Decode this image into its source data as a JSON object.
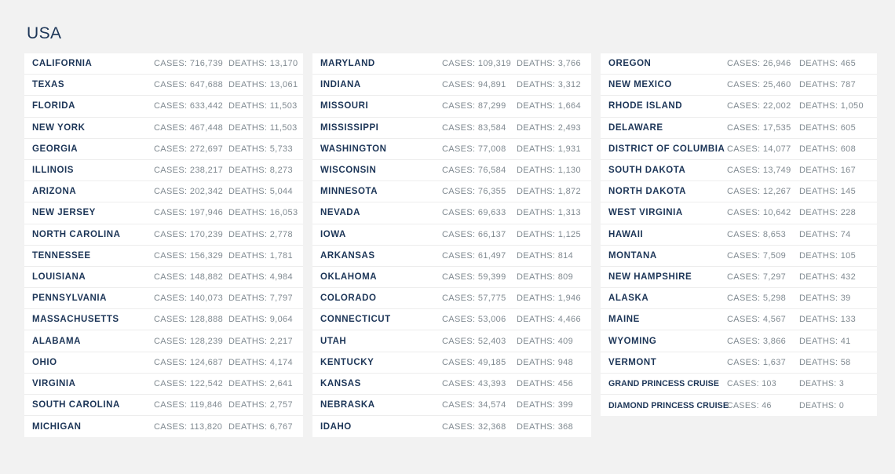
{
  "header": {
    "title": "USA"
  },
  "labels": {
    "cases_prefix": "CASES:",
    "deaths_prefix": "DEATHS:"
  },
  "colors": {
    "background": "#f2f2f2",
    "card": "#ffffff",
    "state_text": "#1c3557",
    "metric_text": "#808a91",
    "row_divider": "#ededed",
    "title": "#1c3557"
  },
  "columns": [
    {
      "rows": [
        {
          "state": "CALIFORNIA",
          "cases": "CASES: 716,739",
          "deaths": "DEATHS: 13,170"
        },
        {
          "state": "TEXAS",
          "cases": "CASES: 647,688",
          "deaths": "DEATHS: 13,061"
        },
        {
          "state": "FLORIDA",
          "cases": "CASES: 633,442",
          "deaths": "DEATHS: 11,503"
        },
        {
          "state": "NEW YORK",
          "cases": "CASES: 467,448",
          "deaths": "DEATHS: 11,503"
        },
        {
          "state": "GEORGIA",
          "cases": "CASES: 272,697",
          "deaths": "DEATHS: 5,733"
        },
        {
          "state": "ILLINOIS",
          "cases": "CASES: 238,217",
          "deaths": "DEATHS: 8,273"
        },
        {
          "state": "ARIZONA",
          "cases": "CASES: 202,342",
          "deaths": "DEATHS: 5,044"
        },
        {
          "state": "NEW JERSEY",
          "cases": "CASES: 197,946",
          "deaths": "DEATHS: 16,053"
        },
        {
          "state": "NORTH CAROLINA",
          "cases": "CASES: 170,239",
          "deaths": "DEATHS: 2,778"
        },
        {
          "state": "TENNESSEE",
          "cases": "CASES: 156,329",
          "deaths": "DEATHS: 1,781"
        },
        {
          "state": "LOUISIANA",
          "cases": "CASES: 148,882",
          "deaths": "DEATHS: 4,984"
        },
        {
          "state": "PENNSYLVANIA",
          "cases": "CASES: 140,073",
          "deaths": "DEATHS: 7,797"
        },
        {
          "state": "MASSACHUSETTS",
          "cases": "CASES: 128,888",
          "deaths": "DEATHS: 9,064"
        },
        {
          "state": "ALABAMA",
          "cases": "CASES: 128,239",
          "deaths": "DEATHS: 2,217"
        },
        {
          "state": "OHIO",
          "cases": "CASES: 124,687",
          "deaths": "DEATHS: 4,174"
        },
        {
          "state": "VIRGINIA",
          "cases": "CASES: 122,542",
          "deaths": "DEATHS: 2,641"
        },
        {
          "state": "SOUTH CAROLINA",
          "cases": "CASES: 119,846",
          "deaths": "DEATHS: 2,757"
        },
        {
          "state": "MICHIGAN",
          "cases": "CASES: 113,820",
          "deaths": "DEATHS: 6,767"
        }
      ]
    },
    {
      "rows": [
        {
          "state": "MARYLAND",
          "cases": "CASES: 109,319",
          "deaths": "DEATHS: 3,766"
        },
        {
          "state": "INDIANA",
          "cases": "CASES: 94,891",
          "deaths": "DEATHS: 3,312"
        },
        {
          "state": "MISSOURI",
          "cases": "CASES: 87,299",
          "deaths": "DEATHS: 1,664"
        },
        {
          "state": "MISSISSIPPI",
          "cases": "CASES: 83,584",
          "deaths": "DEATHS: 2,493"
        },
        {
          "state": "WASHINGTON",
          "cases": "CASES: 77,008",
          "deaths": "DEATHS: 1,931"
        },
        {
          "state": "WISCONSIN",
          "cases": "CASES: 76,584",
          "deaths": "DEATHS: 1,130"
        },
        {
          "state": "MINNESOTA",
          "cases": "CASES: 76,355",
          "deaths": "DEATHS: 1,872"
        },
        {
          "state": "NEVADA",
          "cases": "CASES: 69,633",
          "deaths": "DEATHS: 1,313"
        },
        {
          "state": "IOWA",
          "cases": "CASES: 66,137",
          "deaths": "DEATHS: 1,125"
        },
        {
          "state": "ARKANSAS",
          "cases": "CASES: 61,497",
          "deaths": "DEATHS: 814"
        },
        {
          "state": "OKLAHOMA",
          "cases": "CASES: 59,399",
          "deaths": "DEATHS: 809"
        },
        {
          "state": "COLORADO",
          "cases": "CASES: 57,775",
          "deaths": "DEATHS: 1,946"
        },
        {
          "state": "CONNECTICUT",
          "cases": "CASES: 53,006",
          "deaths": "DEATHS: 4,466"
        },
        {
          "state": "UTAH",
          "cases": "CASES: 52,403",
          "deaths": "DEATHS: 409"
        },
        {
          "state": "KENTUCKY",
          "cases": "CASES: 49,185",
          "deaths": "DEATHS: 948"
        },
        {
          "state": "KANSAS",
          "cases": "CASES: 43,393",
          "deaths": "DEATHS: 456"
        },
        {
          "state": "NEBRASKA",
          "cases": "CASES: 34,574",
          "deaths": "DEATHS: 399"
        },
        {
          "state": "IDAHO",
          "cases": "CASES: 32,368",
          "deaths": "DEATHS: 368"
        }
      ]
    },
    {
      "rows": [
        {
          "state": "OREGON",
          "cases": "CASES: 26,946",
          "deaths": "DEATHS: 465"
        },
        {
          "state": "NEW MEXICO",
          "cases": "CASES: 25,460",
          "deaths": "DEATHS: 787"
        },
        {
          "state": "RHODE ISLAND",
          "cases": "CASES: 22,002",
          "deaths": "DEATHS: 1,050"
        },
        {
          "state": "DELAWARE",
          "cases": "CASES: 17,535",
          "deaths": "DEATHS: 605"
        },
        {
          "state": "DISTRICT OF COLUMBIA",
          "cases": "CASES: 14,077",
          "deaths": "DEATHS: 608"
        },
        {
          "state": "SOUTH DAKOTA",
          "cases": "CASES: 13,749",
          "deaths": "DEATHS: 167"
        },
        {
          "state": "NORTH DAKOTA",
          "cases": "CASES: 12,267",
          "deaths": "DEATHS: 145"
        },
        {
          "state": "WEST VIRGINIA",
          "cases": "CASES: 10,642",
          "deaths": "DEATHS: 228"
        },
        {
          "state": "HAWAII",
          "cases": "CASES: 8,653",
          "deaths": "DEATHS: 74"
        },
        {
          "state": "MONTANA",
          "cases": "CASES: 7,509",
          "deaths": "DEATHS: 105"
        },
        {
          "state": "NEW HAMPSHIRE",
          "cases": "CASES: 7,297",
          "deaths": "DEATHS: 432"
        },
        {
          "state": "ALASKA",
          "cases": "CASES: 5,298",
          "deaths": "DEATHS: 39"
        },
        {
          "state": "MAINE",
          "cases": "CASES: 4,567",
          "deaths": "DEATHS: 133"
        },
        {
          "state": "WYOMING",
          "cases": "CASES: 3,866",
          "deaths": "DEATHS: 41"
        },
        {
          "state": "VERMONT",
          "cases": "CASES: 1,637",
          "deaths": "DEATHS: 58"
        },
        {
          "state": "GRAND PRINCESS CRUISE",
          "cases": "CASES: 103",
          "deaths": "DEATHS: 3",
          "compact": true
        },
        {
          "state": "DIAMOND PRINCESS CRUISE",
          "cases": "CASES: 46",
          "deaths": "DEATHS: 0",
          "compact": true
        }
      ]
    }
  ]
}
